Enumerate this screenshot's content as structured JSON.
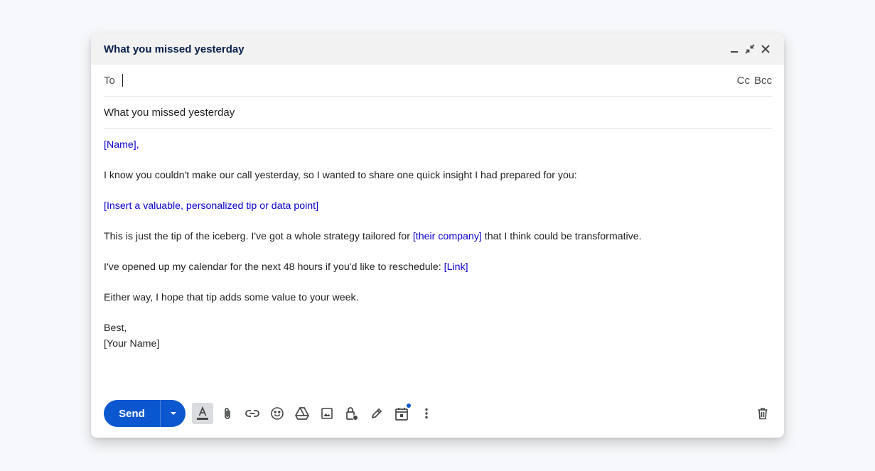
{
  "compose": {
    "title": "What you missed yesterday",
    "to_label": "To",
    "cc_label": "Cc",
    "bcc_label": "Bcc",
    "subject": "What you missed yesterday"
  },
  "body": {
    "greeting_name": "[Name]",
    "greeting_suffix": ",",
    "line1": "I know you couldn't make our call yesterday, so I wanted to share one quick insight I had prepared for you:",
    "tip_placeholder": "[Insert a valuable, personalized tip or data point]",
    "line3_before": "This is just the tip of the iceberg. I've got a whole strategy tailored for ",
    "line3_placeholder": "[their company]",
    "line3_after": " that I think could be transformative.",
    "line4_before": "I've opened up my calendar for the next 48 hours if you'd like to reschedule: ",
    "line4_link": "[Link]",
    "line5": "Either way, I hope that tip adds some value to your week.",
    "signoff": "Best,",
    "signature": "[Your Name]"
  },
  "toolbar": {
    "send_label": "Send",
    "icons": [
      "formatting-icon",
      "attach-icon",
      "link-icon",
      "emoji-icon",
      "drive-icon",
      "photo-icon",
      "confidential-lock-icon",
      "signature-pen-icon",
      "schedule-calendar-icon",
      "more-options-icon",
      "delete-trash-icon"
    ]
  },
  "colors": {
    "send_blue": "#0b57d0",
    "placeholder_blue": "#0b00cc",
    "title_color": "#041e49"
  }
}
